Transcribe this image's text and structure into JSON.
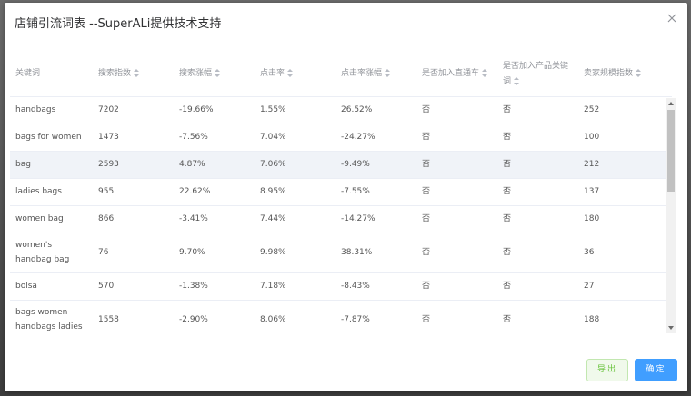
{
  "dialog": {
    "title": "店铺引流词表 --SuperALi提供技术支持"
  },
  "table": {
    "headers": [
      {
        "label": "关键词",
        "sortable": false
      },
      {
        "label": "搜索指数",
        "sortable": true
      },
      {
        "label": "搜索涨幅",
        "sortable": true
      },
      {
        "label": "点击率",
        "sortable": true
      },
      {
        "label": "点击率涨幅",
        "sortable": true
      },
      {
        "label": "是否加入直通车",
        "sortable": true
      },
      {
        "label": "是否加入产品关键词",
        "sortable": true
      },
      {
        "label": "卖家规模指数",
        "sortable": true
      }
    ],
    "rows": [
      [
        "handbags",
        "7202",
        "-19.66%",
        "1.55%",
        "26.52%",
        "否",
        "否",
        "252"
      ],
      [
        "bags for women",
        "1473",
        "-7.56%",
        "7.04%",
        "-24.27%",
        "否",
        "否",
        "100"
      ],
      [
        "bag",
        "2593",
        "4.87%",
        "7.06%",
        "-9.49%",
        "否",
        "否",
        "212"
      ],
      [
        "ladies bags",
        "955",
        "22.62%",
        "8.95%",
        "-7.55%",
        "否",
        "否",
        "137"
      ],
      [
        "women bag",
        "866",
        "-3.41%",
        "7.44%",
        "-14.27%",
        "否",
        "否",
        "180"
      ],
      [
        "women's handbag bag",
        "76",
        "9.70%",
        "9.98%",
        "38.31%",
        "否",
        "否",
        "36"
      ],
      [
        "bolsa",
        "570",
        "-1.38%",
        "7.18%",
        "-8.43%",
        "否",
        "否",
        "27"
      ],
      [
        "bags women handbags ladies",
        "1558",
        "-2.90%",
        "8.06%",
        "-7.87%",
        "否",
        "否",
        "188"
      ]
    ]
  },
  "footer": {
    "export_label": "导出",
    "ok_label": "确定"
  },
  "colors": {
    "primary": "#409eff",
    "success": "#67c23a",
    "row_highlight": "#f0f3f8"
  }
}
